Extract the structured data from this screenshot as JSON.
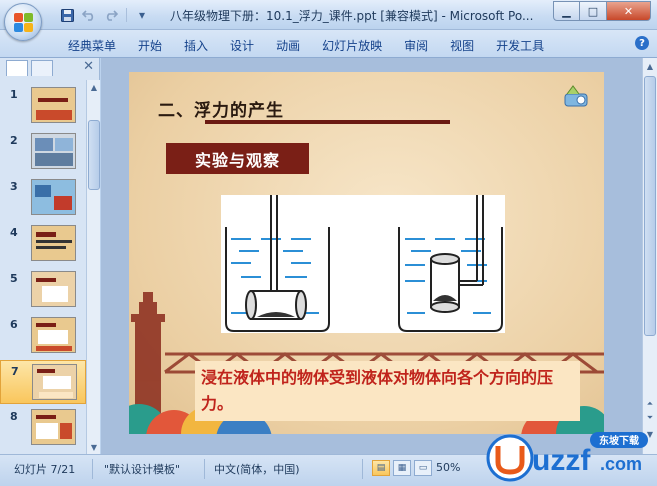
{
  "window": {
    "title": "八年级物理下册：10.1_浮力_课件.ppt [兼容模式] - Microsoft Po...",
    "controls": {
      "minimize": "▁",
      "maximize": "□",
      "close": "✕"
    }
  },
  "quick_access": {
    "save_icon": "save-icon",
    "undo_icon": "undo-icon",
    "redo_icon": "redo-icon",
    "more": "▾"
  },
  "ribbon": {
    "tabs": [
      "经典菜单",
      "开始",
      "插入",
      "设计",
      "动画",
      "幻灯片放映",
      "审阅",
      "视图",
      "开发工具"
    ],
    "help": "?"
  },
  "left_panel": {
    "close": "✕",
    "thumbnails": [
      {
        "num": "1"
      },
      {
        "num": "2"
      },
      {
        "num": "3"
      },
      {
        "num": "4"
      },
      {
        "num": "5"
      },
      {
        "num": "6"
      },
      {
        "num": "7"
      },
      {
        "num": "8"
      }
    ],
    "selected_index": 6
  },
  "slide": {
    "title": "二、浮力的产生",
    "tag": "实验与观察",
    "bottom_text": "浸在液体中的物体受到液体对物体向各个方向的压力。"
  },
  "status": {
    "slide_info": "幻灯片 7/21",
    "template": "\"默认设计模板\"",
    "language": "中文(简体，中国)",
    "zoom": "50%"
  },
  "watermark": {
    "brand": "uzzf",
    "domain": ".com",
    "tag": "东坡下载"
  },
  "colors": {
    "accent": "#7a1f16",
    "text_red": "#c0241c",
    "ribbon_text": "#15428b"
  }
}
